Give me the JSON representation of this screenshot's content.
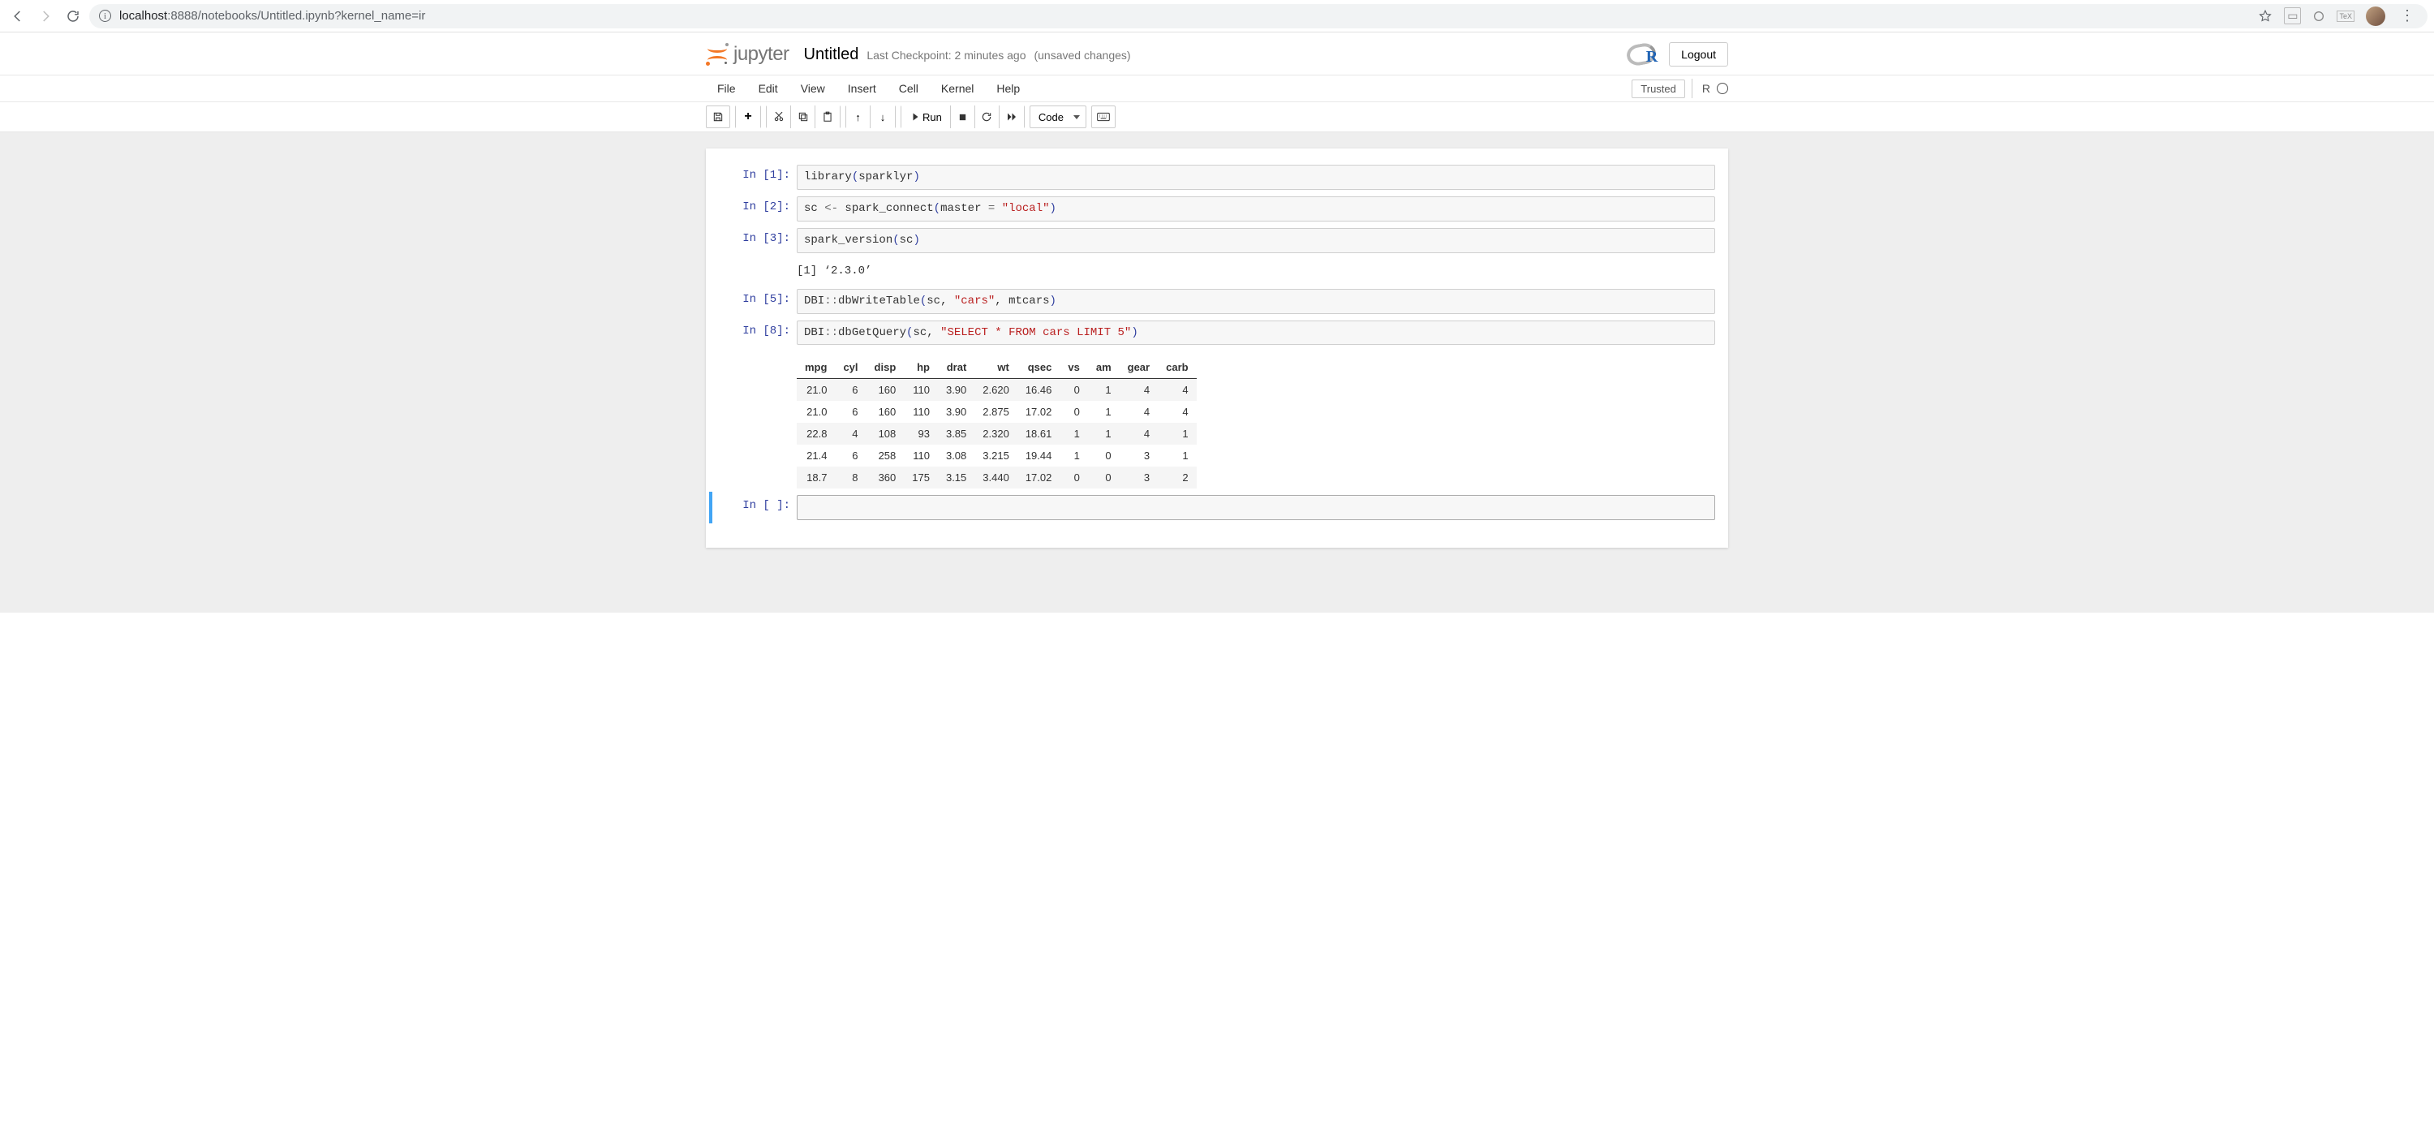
{
  "browser": {
    "url_host": "localhost",
    "url_port": ":8888",
    "url_path": "/notebooks/Untitled.ipynb?kernel_name=ir"
  },
  "header": {
    "logo_text": "jupyter",
    "title": "Untitled",
    "checkpoint": "Last Checkpoint: 2 minutes ago",
    "unsaved": "(unsaved changes)",
    "logout": "Logout"
  },
  "menus": [
    "File",
    "Edit",
    "View",
    "Insert",
    "Cell",
    "Kernel",
    "Help"
  ],
  "trusted": "Trusted",
  "kernel": {
    "name": "R"
  },
  "toolbar": {
    "run": "Run",
    "celltype": "Code"
  },
  "cells": [
    {
      "prompt": "In [1]:",
      "code_tokens": [
        {
          "t": "library",
          "c": ""
        },
        {
          "t": "(",
          "c": "paren"
        },
        {
          "t": "sparklyr",
          "c": ""
        },
        {
          "t": ")",
          "c": "paren"
        }
      ]
    },
    {
      "prompt": "In [2]:",
      "code_tokens": [
        {
          "t": "sc ",
          "c": ""
        },
        {
          "t": "<-",
          "c": "tok-op"
        },
        {
          "t": " spark_connect",
          "c": ""
        },
        {
          "t": "(",
          "c": "paren"
        },
        {
          "t": "master ",
          "c": ""
        },
        {
          "t": "=",
          "c": "tok-op"
        },
        {
          "t": " ",
          "c": ""
        },
        {
          "t": "\"local\"",
          "c": "tok-str"
        },
        {
          "t": ")",
          "c": "paren"
        }
      ]
    },
    {
      "prompt": "In [3]:",
      "code_tokens": [
        {
          "t": "spark_version",
          "c": ""
        },
        {
          "t": "(",
          "c": "paren"
        },
        {
          "t": "sc",
          "c": ""
        },
        {
          "t": ")",
          "c": "paren"
        }
      ],
      "output_text": "[1] ‘2.3.0’"
    },
    {
      "prompt": "In [5]:",
      "code_tokens": [
        {
          "t": "DBI",
          "c": ""
        },
        {
          "t": "::",
          "c": "tok-op"
        },
        {
          "t": "dbWriteTable",
          "c": ""
        },
        {
          "t": "(",
          "c": "paren"
        },
        {
          "t": "sc, ",
          "c": ""
        },
        {
          "t": "\"cars\"",
          "c": "tok-str"
        },
        {
          "t": ", mtcars",
          "c": ""
        },
        {
          "t": ")",
          "c": "paren"
        }
      ]
    },
    {
      "prompt": "In [8]:",
      "code_tokens": [
        {
          "t": "DBI",
          "c": ""
        },
        {
          "t": "::",
          "c": "tok-op"
        },
        {
          "t": "dbGetQuery",
          "c": ""
        },
        {
          "t": "(",
          "c": "paren"
        },
        {
          "t": "sc, ",
          "c": ""
        },
        {
          "t": "\"SELECT * FROM cars LIMIT 5\"",
          "c": "tok-str"
        },
        {
          "t": ")",
          "c": "paren"
        }
      ],
      "table": {
        "headers": [
          "mpg",
          "cyl",
          "disp",
          "hp",
          "drat",
          "wt",
          "qsec",
          "vs",
          "am",
          "gear",
          "carb"
        ],
        "rows": [
          [
            "21.0",
            "6",
            "160",
            "110",
            "3.90",
            "2.620",
            "16.46",
            "0",
            "1",
            "4",
            "4"
          ],
          [
            "21.0",
            "6",
            "160",
            "110",
            "3.90",
            "2.875",
            "17.02",
            "0",
            "1",
            "4",
            "4"
          ],
          [
            "22.8",
            "4",
            "108",
            "93",
            "3.85",
            "2.320",
            "18.61",
            "1",
            "1",
            "4",
            "1"
          ],
          [
            "21.4",
            "6",
            "258",
            "110",
            "3.08",
            "3.215",
            "19.44",
            "1",
            "0",
            "3",
            "1"
          ],
          [
            "18.7",
            "8",
            "360",
            "175",
            "3.15",
            "3.440",
            "17.02",
            "0",
            "0",
            "3",
            "2"
          ]
        ]
      }
    },
    {
      "prompt": "In [ ]:",
      "code_tokens": [],
      "selected": true
    }
  ]
}
